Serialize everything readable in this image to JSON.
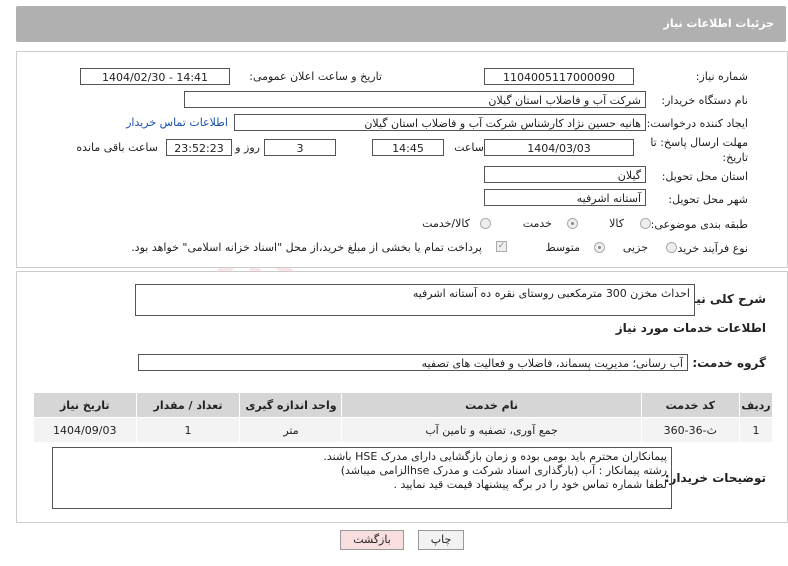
{
  "header": {
    "title": "جزئیات اطلاعات نیاز"
  },
  "fields": {
    "need_number_label": "شماره نیاز:",
    "need_number": "1104005117000090",
    "announce_label": "تاریخ و ساعت اعلان عمومی:",
    "announce_value": "1404/02/30 - 14:41",
    "buyer_org_label": "نام دستگاه خریدار:",
    "buyer_org": "شرکت آب و فاضلاب استان گیلان",
    "creator_label": "ایجاد کننده درخواست:",
    "creator": "هانیه حسین نژاد کارشناس شرکت آب و فاضلاب استان گیلان",
    "contact_link": "اطلاعات تماس خریدار",
    "deadline_label_1": "مهلت ارسال پاسخ: تا",
    "deadline_label_2": "تاریخ:",
    "deadline_date": "1404/03/03",
    "time_label": "ساعت",
    "deadline_time": "14:45",
    "days": "3",
    "days_label": "روز و",
    "remaining": "23:52:23",
    "remaining_label": "ساعت باقی مانده",
    "province_label": "استان محل تحویل:",
    "province": "گیلان",
    "city_label": "شهر محل تحویل:",
    "city": "آستانه اشرفیه",
    "category_label": "طبقه بندی موضوعی:",
    "category_options": [
      "کالا",
      "خدمت",
      "کالا/خدمت"
    ],
    "category_selected": "خدمت",
    "process_label": "نوع فرآیند خرید :",
    "process_options": [
      "جزیی",
      "متوسط"
    ],
    "process_selected": "متوسط",
    "payment_note": "پرداخت تمام یا بخشی از مبلغ خرید،از محل \"اسناد خزانه اسلامی\" خواهد بود."
  },
  "summary": {
    "label": "شرح کلی نیاز:",
    "value": "احداث مخزن 300 مترمکعبی روستای نقره ده آستانه اشرفیه"
  },
  "services": {
    "section_title": "اطلاعات خدمات مورد نیاز",
    "group_label": "گروه خدمت:",
    "group_value": "آب رسانی؛ مدیریت پسماند، فاضلاب و فعالیت های تصفیه",
    "columns": [
      "ردیف",
      "کد خدمت",
      "نام خدمت",
      "واحد اندازه گیری",
      "تعداد / مقدار",
      "تاریخ نیاز"
    ],
    "rows": [
      [
        "1",
        "ث-36-360",
        "جمع آوری، تصفیه و تامین آب",
        "متر",
        "1",
        "1404/09/03"
      ]
    ]
  },
  "buyer_notes": {
    "label": "توضیحات خریدار:",
    "lines": [
      "پیمانکاران محترم باید بومی بوده و  زمان بازگشایی دارای مدرک HSE باشند.",
      "رشته پیمانکار : آب   (بارگذاری اسناد شرکت و مدرک  hseالزامی میباشد)",
      "لطفا شماره تماس خود را در برگه پیشنهاد قیمت قید نمایید ."
    ]
  },
  "buttons": {
    "print": "چاپ",
    "back": "بازگشت"
  },
  "colors": {
    "header_bg": "#b0b0b0",
    "link": "#1a4fb3",
    "back_btn_bg": "#f9dede"
  }
}
